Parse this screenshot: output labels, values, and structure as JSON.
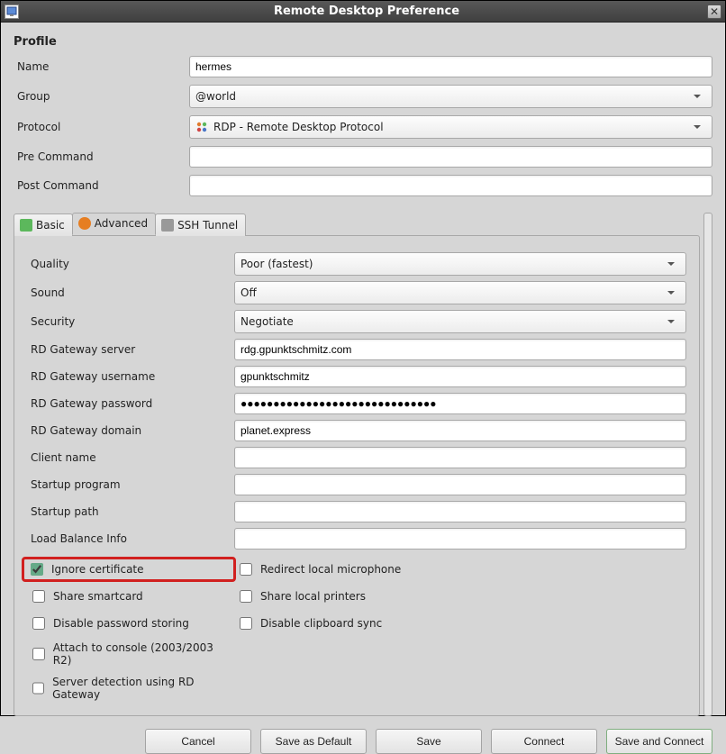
{
  "window": {
    "title": "Remote Desktop Preference"
  },
  "profile": {
    "heading": "Profile",
    "name_label": "Name",
    "name_value": "hermes",
    "group_label": "Group",
    "group_value": "@world",
    "protocol_label": "Protocol",
    "protocol_value": "RDP - Remote Desktop Protocol",
    "precmd_label": "Pre Command",
    "precmd_value": "",
    "postcmd_label": "Post Command",
    "postcmd_value": ""
  },
  "tabs": {
    "basic": "Basic",
    "advanced": "Advanced",
    "ssh": "SSH Tunnel"
  },
  "advanced": {
    "quality_label": "Quality",
    "quality_value": "Poor (fastest)",
    "sound_label": "Sound",
    "sound_value": "Off",
    "security_label": "Security",
    "security_value": "Negotiate",
    "rdgw_server_label": "RD Gateway server",
    "rdgw_server_value": "rdg.gpunktschmitz.com",
    "rdgw_user_label": "RD Gateway username",
    "rdgw_user_value": "gpunktschmitz",
    "rdgw_pass_label": "RD Gateway password",
    "rdgw_pass_value": "●●●●●●●●●●●●●●●●●●●●●●●●●●●●●●",
    "rdgw_domain_label": "RD Gateway domain",
    "rdgw_domain_value": "planet.express",
    "client_name_label": "Client name",
    "client_name_value": "",
    "startup_prog_label": "Startup program",
    "startup_prog_value": "",
    "startup_path_label": "Startup path",
    "startup_path_value": "",
    "loadbalance_label": "Load Balance Info",
    "loadbalance_value": ""
  },
  "checks": {
    "ignore_cert": "Ignore certificate",
    "redirect_mic": "Redirect local microphone",
    "share_smartcard": "Share smartcard",
    "share_printers": "Share local printers",
    "disable_pw_store": "Disable password storing",
    "disable_clip": "Disable clipboard sync",
    "attach_console": "Attach to console (2003/2003 R2)",
    "server_detect_rdgw": "Server detection using RD Gateway"
  },
  "buttons": {
    "cancel": "Cancel",
    "save_default": "Save as Default",
    "save": "Save",
    "connect": "Connect",
    "save_connect": "Save and Connect"
  }
}
